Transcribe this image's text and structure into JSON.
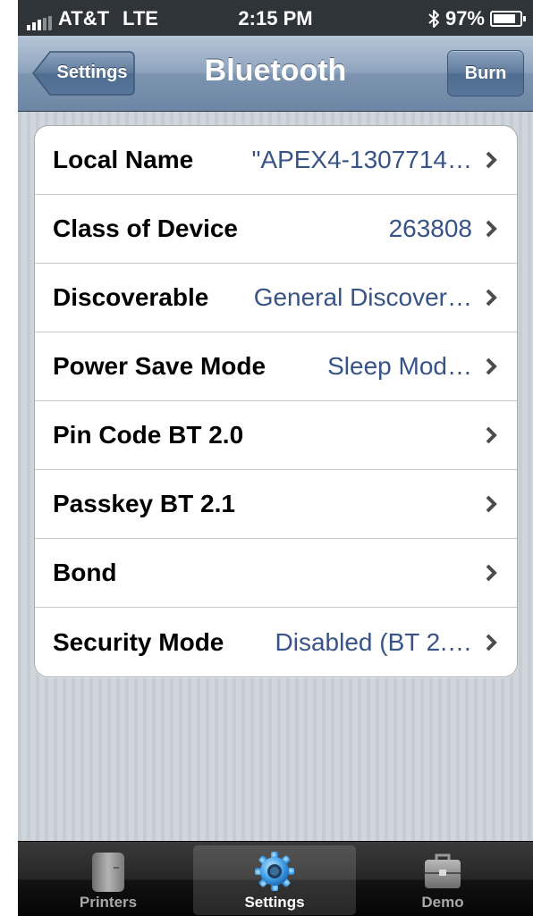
{
  "status_bar": {
    "carrier": "AT&T",
    "network": "LTE",
    "time": "2:15 PM",
    "battery": "97%",
    "battery_level": 0.97
  },
  "nav": {
    "back_label": "Settings",
    "title": "Bluetooth",
    "action_label": "Burn"
  },
  "rows": [
    {
      "label": "Local Name",
      "value": "\"APEX4-1307714…"
    },
    {
      "label": "Class of Device",
      "value": "263808"
    },
    {
      "label": "Discoverable",
      "value": "General Discover…"
    },
    {
      "label": "Power Save Mode",
      "value": "Sleep Mod…"
    },
    {
      "label": "Pin Code BT 2.0",
      "value": ""
    },
    {
      "label": "Passkey BT 2.1",
      "value": ""
    },
    {
      "label": "Bond",
      "value": ""
    },
    {
      "label": "Security Mode",
      "value": "Disabled (BT 2.…"
    }
  ],
  "tabs": [
    {
      "label": "Printers",
      "icon": "printer-icon",
      "active": false
    },
    {
      "label": "Settings",
      "icon": "gear-icon",
      "active": true
    },
    {
      "label": "Demo",
      "icon": "briefcase-icon",
      "active": false
    }
  ],
  "colors": {
    "nav_bar": "#8ea4bd",
    "value_text": "#385487",
    "background": "#cbd2d8",
    "tab_bar": "#1a1a1a"
  }
}
